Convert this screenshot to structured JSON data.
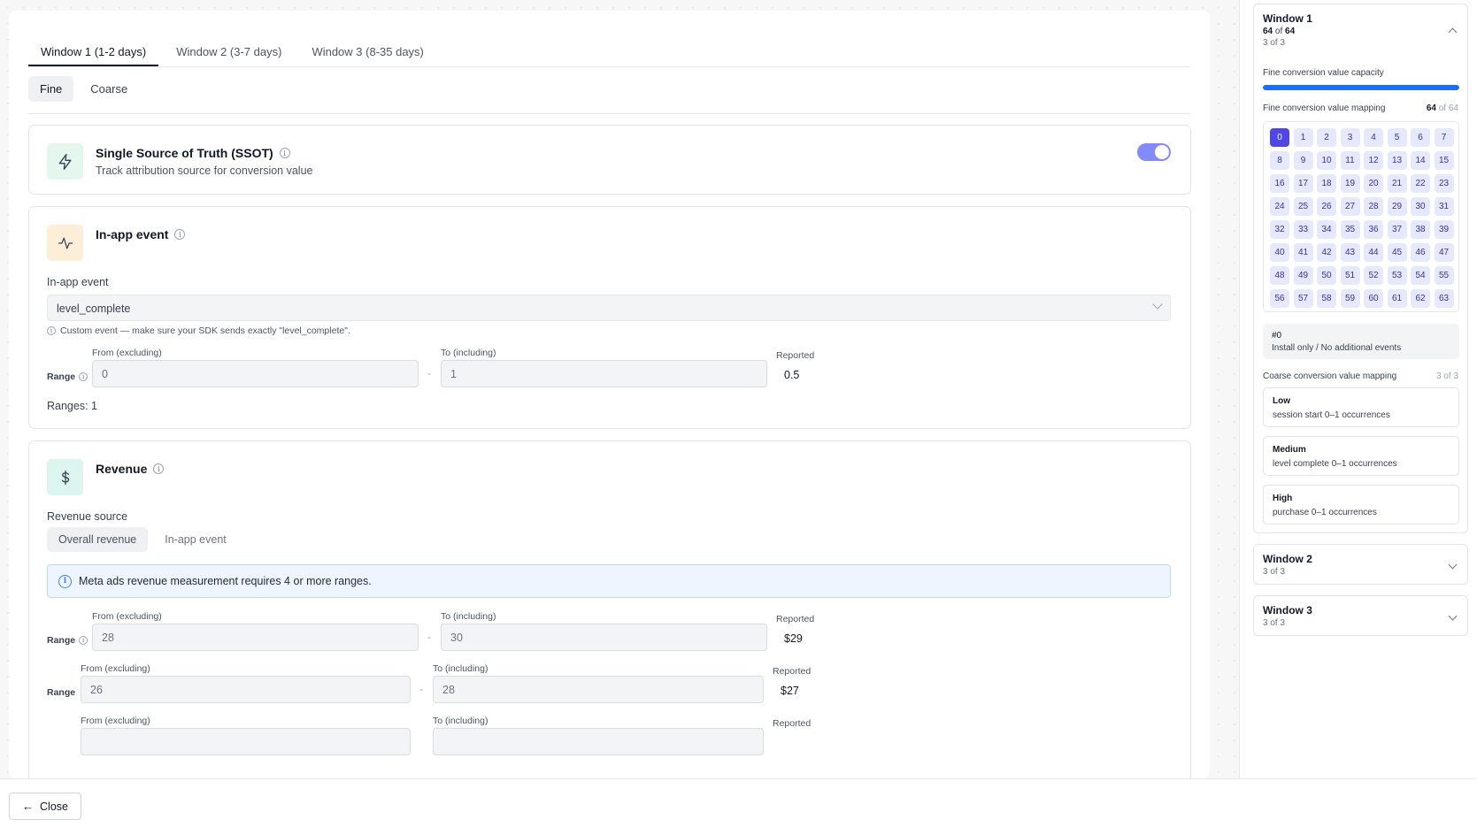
{
  "tabs": [
    "Window 1 (1-2 days)",
    "Window 2 (3-7 days)",
    "Window 3 (8-35 days)"
  ],
  "granularity": {
    "fine": "Fine",
    "coarse": "Coarse"
  },
  "ssot": {
    "title": "Single Source of Truth (SSOT)",
    "subtitle": "Track attribution source for conversion value",
    "enabled": true
  },
  "in_app_event": {
    "title": "In-app event",
    "field_label": "In-app event",
    "selected": "level_complete",
    "hint": "Custom event — make sure your SDK sends exactly \"level_complete\".",
    "from_label": "From (excluding)",
    "to_label": "To (including)",
    "range_label": "Range",
    "reported_label": "Reported",
    "range": {
      "from": "0",
      "to": "1",
      "reported": "0.5"
    },
    "ranges_count": "Ranges: 1"
  },
  "revenue": {
    "title": "Revenue",
    "source_label": "Revenue source",
    "source_options": [
      "Overall revenue",
      "In-app event"
    ],
    "banner": "Meta ads revenue measurement requires 4 or more ranges.",
    "from_label": "From (excluding)",
    "to_label": "To (including)",
    "range_label": "Range",
    "reported_label": "Reported",
    "ranges": [
      {
        "from": "28",
        "to": "30",
        "reported": "$29"
      },
      {
        "from": "26",
        "to": "28",
        "reported": "$27"
      },
      {
        "from": "",
        "to": "",
        "reported": ""
      }
    ]
  },
  "footer": {
    "close_label": "Close"
  },
  "sidebar": {
    "window1": {
      "title": "Window 1",
      "used": "64",
      "of": "of",
      "total": "64",
      "sub": "3 of 3",
      "capacity_label": "Fine conversion value capacity",
      "capacity_fraction": 1.0,
      "mapping_label": "Fine conversion value mapping",
      "mapping_used": "64",
      "mapping_of": "of 64",
      "selected_value": 0,
      "value_count": 64,
      "selected_code": "#0",
      "selected_desc": "Install only / No additional events",
      "coarse_label": "Coarse conversion value mapping",
      "coarse_count": "3 of 3",
      "coarse": [
        {
          "name": "Low",
          "desc": "session start 0–1 occurrences"
        },
        {
          "name": "Medium",
          "desc": "level complete 0–1 occurrences"
        },
        {
          "name": "High",
          "desc": "purchase 0–1 occurrences"
        }
      ]
    },
    "window2": {
      "title": "Window 2",
      "sub": "3 of 3"
    },
    "window3": {
      "title": "Window 3",
      "sub": "3 of 3"
    }
  },
  "colors": {
    "accent": "#4f46e5",
    "capacity": "#1d6ff2",
    "toggle": "#818cf8"
  }
}
